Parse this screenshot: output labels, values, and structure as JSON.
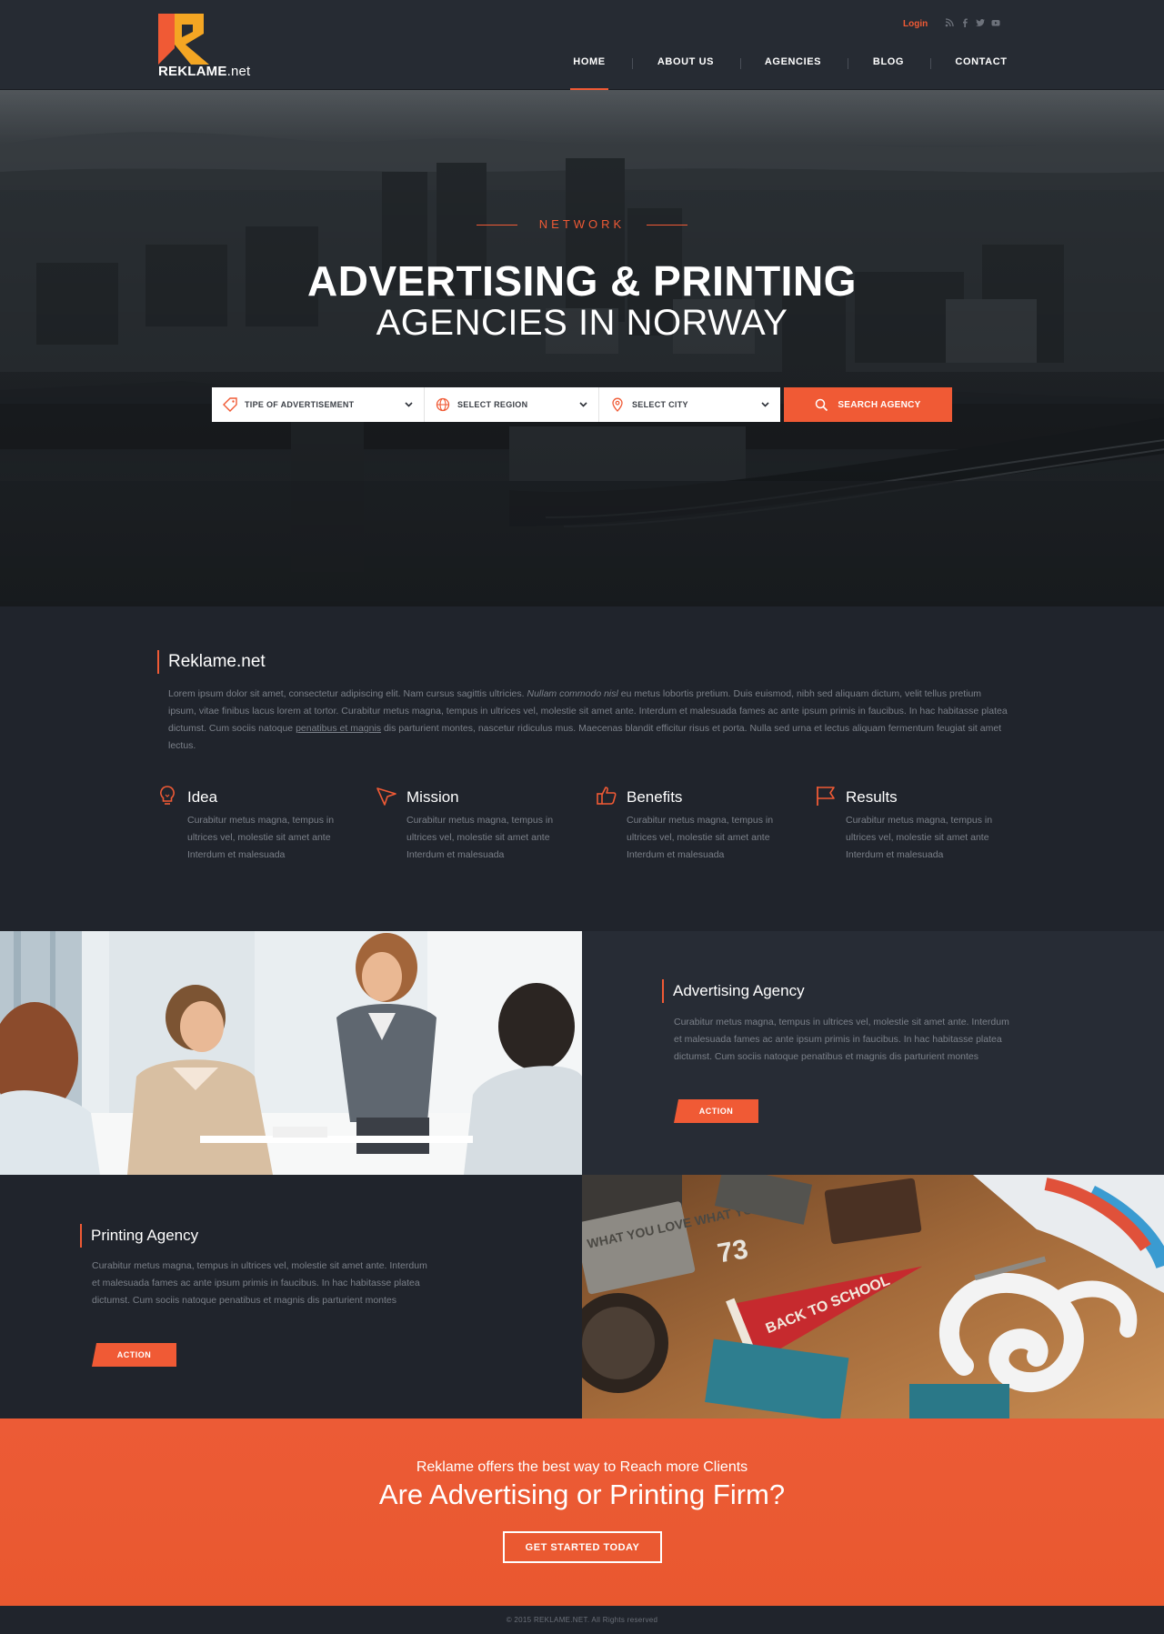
{
  "brand": {
    "name": "REKLAME",
    "suffix": ".net",
    "accent_color": "#f05a35",
    "dark_color": "#20242c"
  },
  "header": {
    "login_label": "Login",
    "socials": [
      "rss-icon",
      "facebook-icon",
      "twitter-icon",
      "youtube-icon"
    ],
    "nav": [
      {
        "label": "HOME",
        "active": true
      },
      {
        "label": "ABOUT US",
        "active": false
      },
      {
        "label": "AGENCIES",
        "active": false
      },
      {
        "label": "BLOG",
        "active": false
      },
      {
        "label": "CONTACT",
        "active": false
      }
    ]
  },
  "hero": {
    "eyebrow": "NETWORK",
    "title": "ADVERTISING & PRINTING",
    "subtitle": "AGENCIES IN NORWAY",
    "search": {
      "type_label": "TIPE OF ADVERTISEMENT",
      "region_label": "SELECT REGION",
      "city_label": "SELECT CITY",
      "button_label": "SEARCH AGENCY"
    }
  },
  "about": {
    "title": "Reklame.net",
    "text_1": "Lorem ipsum dolor sit amet, consectetur adipiscing elit. Nam cursus sagittis ultricies. ",
    "text_em": "Nullam commodo nisl",
    "text_2": " eu metus lobortis pretium. Duis euismod, nibh sed aliquam dictum, velit tellus pretium ipsum, vitae finibus lacus lorem at tortor. Curabitur metus magna, tempus in ultrices vel, molestie sit amet ante. Interdum et malesuada fames ac ante ipsum primis in faucibus. In hac habitasse platea dictumst. Cum sociis natoque ",
    "text_link": "penatibus et magnis",
    "text_3": " dis parturient montes, nascetur ridiculus mus. Maecenas blandit efficitur risus et porta. Nulla sed urna et lectus aliquam fermentum feugiat sit amet lectus.",
    "features": [
      {
        "icon": "lightbulb-icon",
        "title": "Idea",
        "text": "Curabitur metus magna, tempus in ultrices vel, molestie sit amet ante Interdum et malesuada"
      },
      {
        "icon": "paper-plane-icon",
        "title": "Mission",
        "text": "Curabitur metus magna, tempus in ultrices vel, molestie sit amet ante Interdum et malesuada"
      },
      {
        "icon": "thumbs-up-icon",
        "title": "Benefits",
        "text": "Curabitur metus magna, tempus in ultrices vel, molestie sit amet ante Interdum et malesuada"
      },
      {
        "icon": "flag-icon",
        "title": "Results",
        "text": "Curabitur metus magna, tempus in ultrices vel, molestie sit amet ante Interdum et malesuada"
      }
    ]
  },
  "advertising": {
    "title": "Advertising Agency",
    "text": "Curabitur metus magna, tempus in ultrices vel, molestie sit amet ante. Interdum et malesuada fames ac ante ipsum primis in faucibus. In hac habitasse platea dictumst. Cum sociis natoque penatibus et magnis dis parturient montes",
    "button_label": "ACTION"
  },
  "printing": {
    "title": "Printing Agency",
    "text": "Curabitur metus magna, tempus in ultrices vel, molestie sit amet ante. Interdum et malesuada fames ac ante ipsum primis in faucibus. In hac habitasse platea dictumst. Cum sociis natoque penatibus et magnis dis parturient montes",
    "button_label": "ACTION",
    "photo_pennant_text": "BACK TO SCHOOL",
    "photo_stamp_text": "WHAT YOU LOVE WHAT YOU DO",
    "photo_number": "73"
  },
  "cta": {
    "subtitle": "Reklame offers the best way to Reach more Clients",
    "title": "Are Advertising or Printing Firm?",
    "button_label": "GET STARTED TODAY"
  },
  "footer": {
    "copyright": "© 2015 REKLAME.NET. All Rights reserved"
  }
}
